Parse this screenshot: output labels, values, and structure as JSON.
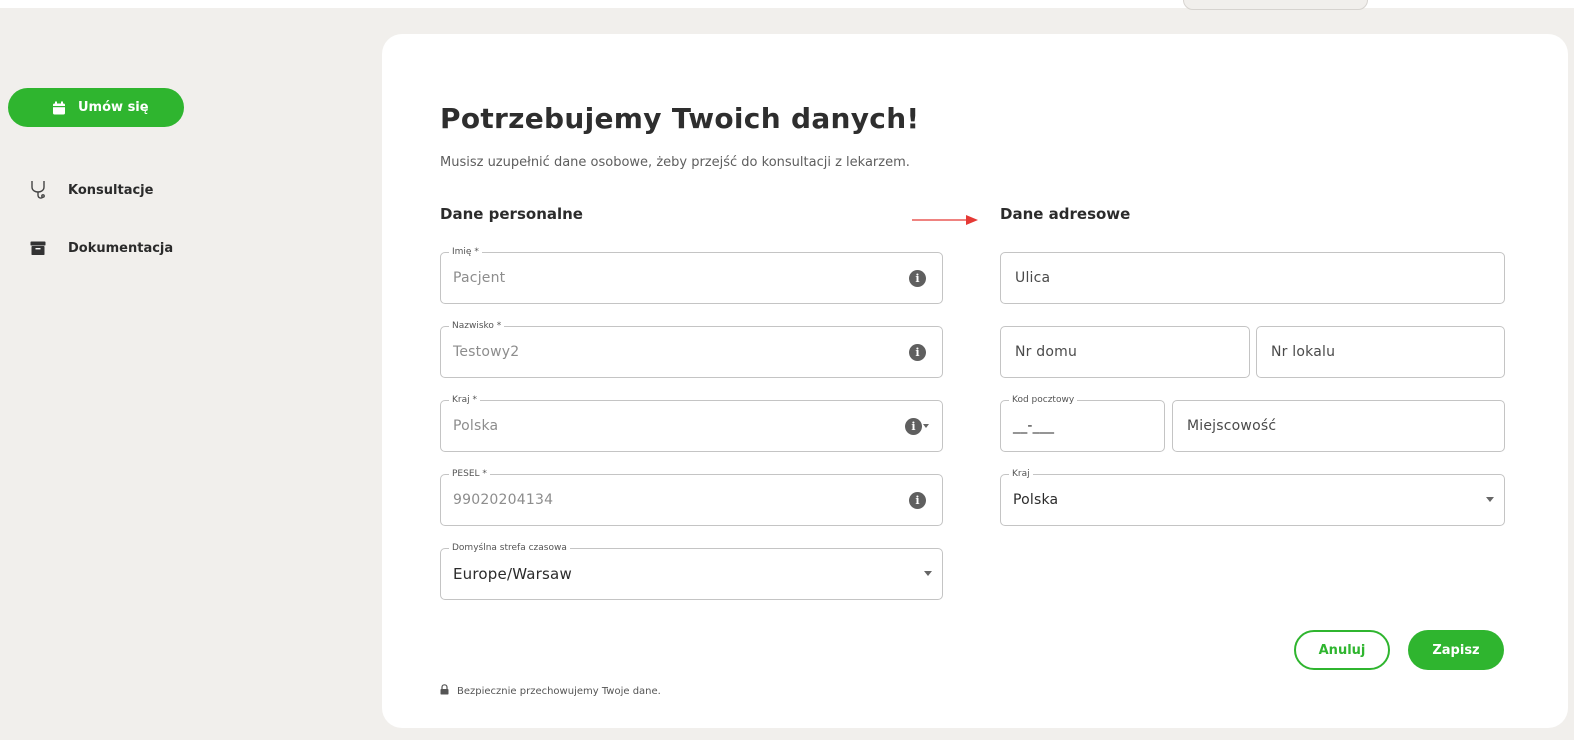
{
  "sidebar": {
    "primary_label": "Umów się",
    "items": [
      {
        "label": "Konsultacje",
        "icon": "stethoscope-icon"
      },
      {
        "label": "Dokumentacja",
        "icon": "archive-icon"
      }
    ]
  },
  "form": {
    "title": "Potrzebujemy Twoich danych!",
    "subtitle": "Musisz uzupełnić dane osobowe, żeby przejść do konsultacji z lekarzem.",
    "personal_header": "Dane personalne",
    "address_header": "Dane adresowe",
    "personal": {
      "first_name": {
        "label": "Imię *",
        "value": "Pacjent"
      },
      "last_name": {
        "label": "Nazwisko *",
        "value": "Testowy2"
      },
      "country": {
        "label": "Kraj *",
        "value": "Polska"
      },
      "pesel": {
        "label": "PESEL *",
        "value": "99020204134"
      },
      "timezone": {
        "label": "Domyślna strefa czasowa",
        "value": "Europe/Warsaw"
      }
    },
    "address": {
      "street": {
        "placeholder": "Ulica"
      },
      "house_no": {
        "placeholder": "Nr domu"
      },
      "flat_no": {
        "placeholder": "Nr lokalu"
      },
      "postal_code": {
        "label": "Kod pocztowy",
        "value": "__-___"
      },
      "city": {
        "placeholder": "Miejscowość"
      },
      "country": {
        "label": "Kraj",
        "value": "Polska"
      }
    },
    "actions": {
      "cancel": "Anuluj",
      "save": "Zapisz"
    },
    "security_note": "Bezpiecznie przechowujemy Twoje dane."
  },
  "colors": {
    "accent": "#2fb52f",
    "arrow": "#e53935"
  }
}
